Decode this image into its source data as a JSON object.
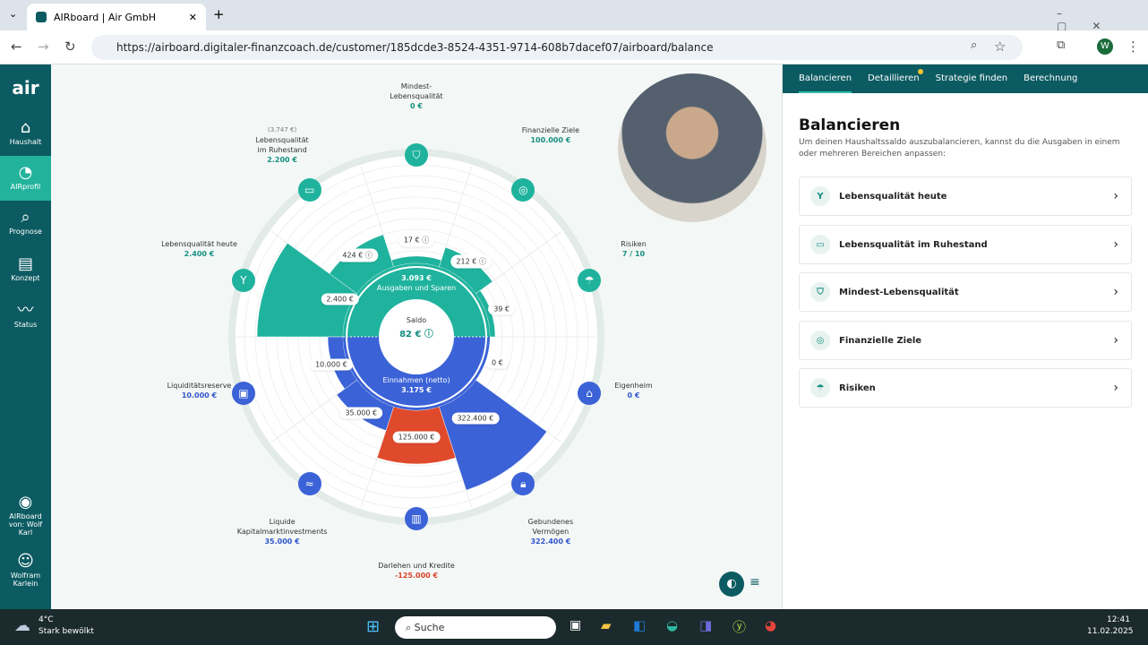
{
  "browser": {
    "tab_title": "AIRboard | Air GmbH",
    "url": "https://airboard.digitaler-finanzcoach.de/customer/185dcde3-8524-4351-9714-608b7dacef07/airboard/balance",
    "profile_initial": "W"
  },
  "sidebar": {
    "logo": "air",
    "items": [
      {
        "label": "Haushalt",
        "icon": "house-icon"
      },
      {
        "label": "AIRprofil",
        "icon": "pie-icon",
        "active": true
      },
      {
        "label": "Prognose",
        "icon": "chart-search-icon"
      },
      {
        "label": "Konzept",
        "icon": "document-icon"
      },
      {
        "label": "Status",
        "icon": "pulse-icon"
      }
    ],
    "viewer_label": "AIRboard von: Wolf Karl",
    "user": "Wolfram Karlein"
  },
  "chart": {
    "saldo_label": "Saldo",
    "saldo_value": "82 €",
    "expenses_total": "3.093 €",
    "expenses_label": "Ausgaben und Sparen",
    "income_label": "Einnahmen (netto)",
    "income_total": "3.175 €",
    "categories": [
      {
        "name": "Lebensqualität heute",
        "value": "2.400 €",
        "pill": "2.400 €"
      },
      {
        "name": "Lebensqualität im Ruhestand",
        "note": "(3.747 €)",
        "value": "2.200 €",
        "pill": "424 €"
      },
      {
        "name": "Mindest-Lebensqualität",
        "value": "0 €",
        "pill": "17 €"
      },
      {
        "name": "Finanzielle Ziele",
        "value": "100.000 €",
        "pill": "212 €"
      },
      {
        "name": "Risiken",
        "value": "7 / 10",
        "pill": "39 €"
      },
      {
        "name": "Eigenheim",
        "value": "0 €",
        "pill": "0 €"
      },
      {
        "name": "Gebundenes Vermögen",
        "value": "322.400 €",
        "pill": "322.400 €"
      },
      {
        "name": "Darlehen und Kredite",
        "value": "-125.000 €",
        "pill": "125.000 €"
      },
      {
        "name": "Liquide Kapitalmarktinvestments",
        "value": "35.000 €",
        "pill": "35.000 €"
      },
      {
        "name": "Liquiditätsreserve",
        "value": "10.000 €",
        "pill": "10.000 €"
      }
    ],
    "colors": {
      "expenses": "#1fb39e",
      "income": "#3b62d6",
      "debt": "#e04a2c"
    }
  },
  "panel": {
    "tabs": [
      "Balancieren",
      "Detaillieren",
      "Strategie finden",
      "Berechnung"
    ],
    "title": "Balancieren",
    "description": "Um deinen Haushaltssaldo auszubalancieren, kannst du die Ausgaben in einem oder mehreren Bereichen anpassen:",
    "cards": [
      "Lebensqualität heute",
      "Lebensqualität im Ruhestand",
      "Mindest-Lebensqualität",
      "Finanzielle Ziele",
      "Risiken"
    ]
  },
  "taskbar": {
    "temp": "4°C",
    "weather": "Stark bewölkt",
    "search": "Suche",
    "time": "12:41",
    "date": "11.02.2025"
  }
}
